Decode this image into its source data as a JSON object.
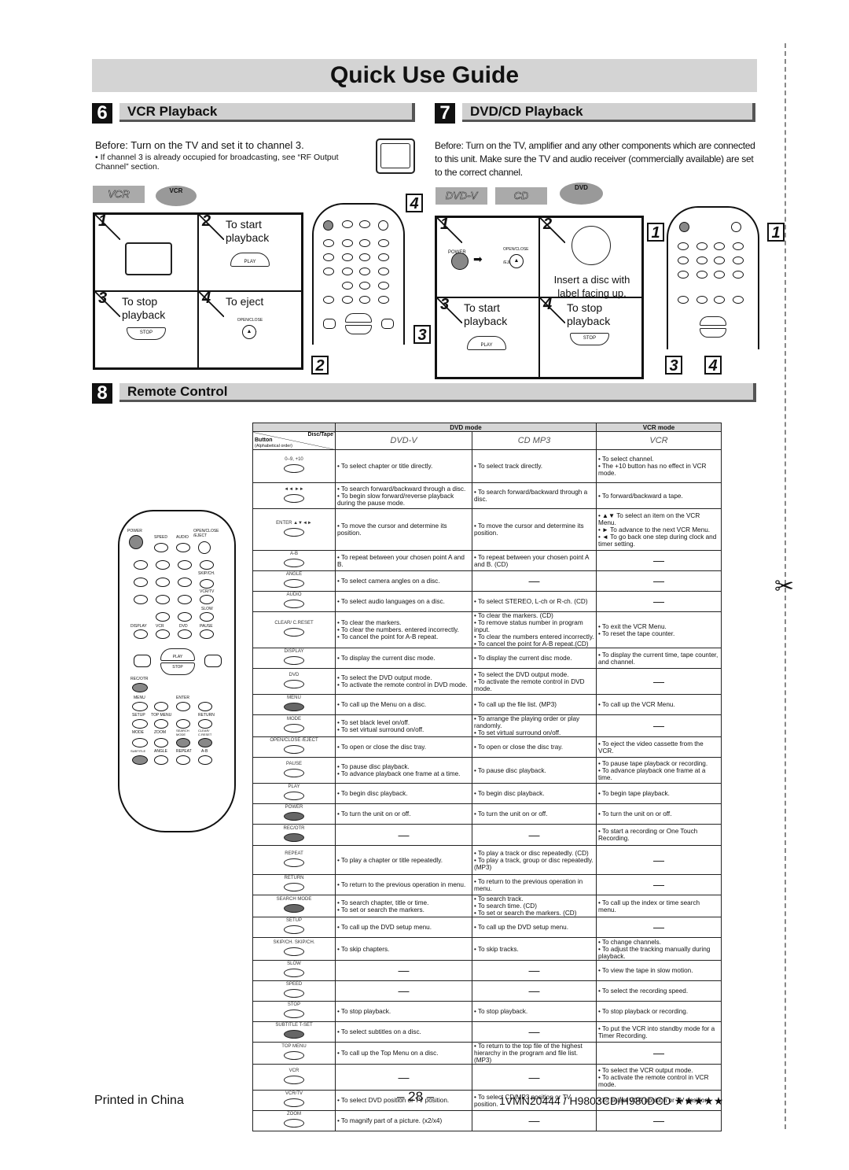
{
  "title": "Quick Use Guide",
  "vcr": {
    "num": "6",
    "heading": "VCR Playback",
    "before": "Before:  Turn on the TV and set it to channel 3.",
    "note": "• If channel 3 is already occupied for broadcasting, see “RF Output Channel” section.",
    "badge": "VCR",
    "remote_key": "VCR",
    "steps": [
      {
        "n": "1",
        "label": ""
      },
      {
        "n": "2",
        "label": "To start playback",
        "btn": "PLAY"
      },
      {
        "n": "3",
        "label": "To stop playback",
        "btn": "STOP"
      },
      {
        "n": "4",
        "label": "To eject",
        "btn": "OPEN/CLOSE /EJECT"
      }
    ],
    "callouts": [
      "4",
      "3",
      "2"
    ]
  },
  "dvd": {
    "num": "7",
    "heading": "DVD/CD Playback",
    "before": "Before: Turn on the TV, amplifier and any other components which are connected to this unit. Make sure the TV and audio receiver (commercially available) are set to the correct channel.",
    "badges": [
      "DVD-V",
      "CD"
    ],
    "remote_key": "DVD",
    "steps": [
      {
        "n": "1",
        "label": "",
        "btn1": "POWER",
        "btn2": "OPEN/CLOSE /EJECT"
      },
      {
        "n": "2",
        "label": "Insert a disc with label facing up."
      },
      {
        "n": "3",
        "label": "To start playback",
        "btn": "PLAY"
      },
      {
        "n": "4",
        "label": "To stop playback",
        "btn": "STOP"
      }
    ],
    "callouts": [
      "1",
      "1",
      "3",
      "4"
    ]
  },
  "remote_labels": {
    "power": "POWER",
    "speed": "SPEED",
    "audio": "AUDIO",
    "eject": "OPEN/CLOSE /EJECT",
    "skip": "SKIP/CH.",
    "vcrtv": "VCR/TV",
    "slow": "SLOW",
    "display": "DISPLAY",
    "vcr": "VCR",
    "dvd": "DVD",
    "pause": "PAUSE",
    "play": "PLAY",
    "stop": "STOP",
    "recotr": "REC/OTR",
    "menu": "MENU",
    "enter": "ENTER",
    "setup": "SETUP",
    "topmenu": "TOP MENU",
    "return": "RETURN",
    "mode": "MODE",
    "zoom": "ZOOM",
    "search": "SEARCH MODE",
    "clear": "CLEAR/ C.RESET",
    "subtitle": "SUBTITLE",
    "angle": "ANGLE",
    "repeat": "REPEAT",
    "ab": "A-B"
  },
  "remote_section": {
    "num": "8",
    "heading": "Remote Control"
  },
  "table": {
    "header": {
      "dvd_mode": "DVD mode",
      "vcr_mode": "VCR mode",
      "button": "Button",
      "order": "(Alphabetical order)",
      "disc_tape": "Disc/Tape",
      "col_dvd": "DVD-V",
      "col_cd": "CD  MP3",
      "col_vcr": "VCR"
    },
    "rows": [
      {
        "button": "0–9, +10",
        "dvd": [
          "To select chapter or title directly."
        ],
        "cd": [
          "To select track directly."
        ],
        "vcr": [
          "To select channel.",
          "The +10 button has no effect in VCR mode."
        ]
      },
      {
        "button": "◄◄  ►►",
        "dvd": [
          "To search forward/backward through a disc.",
          "To begin slow forward/reverse playback during the pause mode."
        ],
        "cd": [
          "To search forward/backward through a disc."
        ],
        "vcr": [
          "To forward/backward a tape."
        ]
      },
      {
        "button": "ENTER ▲▼◄►",
        "dvd": [
          "To move the cursor and determine its position."
        ],
        "cd": [
          "To move the cursor and determine its position."
        ],
        "vcr": [
          "▲▼ To select an item on the VCR Menu.",
          "► To advance to the next VCR Menu.",
          "◄ To go back one step during clock and timer setting."
        ]
      },
      {
        "button": "A-B",
        "dvd": [
          "To repeat between your chosen point A and B."
        ],
        "cd": [
          "To repeat between your chosen point A and B. (CD)"
        ],
        "vcr": []
      },
      {
        "button": "ANGLE",
        "dvd": [
          "To select camera angles on a disc."
        ],
        "cd": [],
        "vcr": []
      },
      {
        "button": "AUDIO",
        "dvd": [
          "To select audio languages on a disc."
        ],
        "cd": [
          "To select STEREO, L-ch or R-ch. (CD)"
        ],
        "vcr": []
      },
      {
        "button": "CLEAR/ C.RESET",
        "dvd": [
          "To clear the markers.",
          "To clear the numbers. entered incorrectly.",
          "To cancel the point for A-B repeat."
        ],
        "cd": [
          "To clear the markers. (CD)",
          "To remove status number in program input.",
          "To clear the numbers entered incorrectly.",
          "To cancel the point for A-B repeat.(CD)"
        ],
        "vcr": [
          "To exit the VCR Menu.",
          "To reset the tape counter."
        ]
      },
      {
        "button": "DISPLAY",
        "dvd": [
          "To display the current disc mode."
        ],
        "cd": [
          "To display the current disc mode."
        ],
        "vcr": [
          "To display the current time, tape counter, and channel."
        ]
      },
      {
        "button": "DVD",
        "dvd": [
          "To select the DVD output mode.",
          "To activate the remote control in DVD mode."
        ],
        "cd": [
          "To select the DVD output mode.",
          "To activate the remote control in DVD mode."
        ],
        "vcr": []
      },
      {
        "button": "MENU",
        "dvd": [
          "To call up the Menu on a disc."
        ],
        "cd": [
          "To call up the file list. (MP3)"
        ],
        "vcr": [
          "To call up the VCR Menu."
        ]
      },
      {
        "button": "MODE",
        "dvd": [
          "To set black level on/off.",
          "To set virtual surround on/off."
        ],
        "cd": [
          "To arrange the playing order or play randomly.",
          "To set virtual surround on/off."
        ],
        "vcr": []
      },
      {
        "button": "OPEN/CLOSE /EJECT",
        "dvd": [
          "To open or close the disc tray."
        ],
        "cd": [
          "To open or close the disc tray."
        ],
        "vcr": [
          "To eject the video cassette from the VCR."
        ]
      },
      {
        "button": "PAUSE",
        "dvd": [
          "To pause disc playback.",
          "To advance playback one frame at a time."
        ],
        "cd": [
          "To pause disc playback."
        ],
        "vcr": [
          "To pause tape playback or recording.",
          "To advance playback one frame at a time."
        ]
      },
      {
        "button": "PLAY",
        "dvd": [
          "To begin disc playback."
        ],
        "cd": [
          "To begin disc playback."
        ],
        "vcr": [
          "To begin tape playback."
        ]
      },
      {
        "button": "POWER",
        "dvd": [
          "To turn the unit on or off."
        ],
        "cd": [
          "To turn the unit on or off."
        ],
        "vcr": [
          "To turn the unit on or off."
        ]
      },
      {
        "button": "REC/OTR",
        "dvd": [],
        "cd": [],
        "vcr": [
          "To start a recording or One Touch Recording."
        ]
      },
      {
        "button": "REPEAT",
        "dvd": [
          "To play a chapter or title repeatedly."
        ],
        "cd": [
          "To play a track or disc repeatedly. (CD)",
          "To play a track, group or disc repeatedly. (MP3)"
        ],
        "vcr": []
      },
      {
        "button": "RETURN",
        "dvd": [
          "To return to the previous operation in menu."
        ],
        "cd": [
          "To return to the previous operation in menu."
        ],
        "vcr": []
      },
      {
        "button": "SEARCH MODE",
        "dvd": [
          "To search chapter, title or time.",
          "To set or search the markers."
        ],
        "cd": [
          "To search track.",
          "To search time. (CD)",
          "To set or search the markers. (CD)"
        ],
        "vcr": [
          "To call up the index or time search menu."
        ]
      },
      {
        "button": "SETUP",
        "dvd": [
          "To call up the DVD setup menu."
        ],
        "cd": [
          "To call up the DVD setup menu."
        ],
        "vcr": []
      },
      {
        "button": "SKIP/CH.  SKIP/CH.",
        "dvd": [
          "To skip chapters."
        ],
        "cd": [
          "To skip tracks."
        ],
        "vcr": [
          "To change channels.",
          "To adjust the tracking manually during playback."
        ]
      },
      {
        "button": "SLOW",
        "dvd": [],
        "cd": [],
        "vcr": [
          "To view the tape in slow motion."
        ]
      },
      {
        "button": "SPEED",
        "dvd": [],
        "cd": [],
        "vcr": [
          "To select the recording speed."
        ]
      },
      {
        "button": "STOP",
        "dvd": [
          "To stop playback."
        ],
        "cd": [
          "To stop playback."
        ],
        "vcr": [
          "To stop playback or recording."
        ]
      },
      {
        "button": "SUBTITLE T-SET",
        "dvd": [
          "To select subtitles on a disc."
        ],
        "cd": [],
        "vcr": [
          "To put the VCR into standby mode for a Timer Recording."
        ]
      },
      {
        "button": "TOP MENU",
        "dvd": [
          "To call up the Top Menu on a disc."
        ],
        "cd": [
          "To return to the top file of the highest hierarchy in the program and file list. (MP3)"
        ],
        "vcr": []
      },
      {
        "button": "VCR",
        "dvd": [],
        "cd": [],
        "vcr": [
          "To select the VCR output mode.",
          "To activate the remote control in VCR mode."
        ]
      },
      {
        "button": "VCR/TV",
        "dvd": [
          "To select DVD position or TV position."
        ],
        "cd": [
          "To select CD/MP3 position or TV position."
        ],
        "vcr": [
          "To select VCR position or TV position."
        ]
      },
      {
        "button": "ZOOM",
        "dvd": [
          "To magnify part of a picture. (x2/x4)"
        ],
        "cd": [],
        "vcr": []
      }
    ]
  },
  "footer": {
    "printed": "Printed in China",
    "page": "– 28 –",
    "model": "1VMN20444 / H9803CD/H980DCD ★★★★★"
  },
  "dash": "—",
  "bullet": "•"
}
